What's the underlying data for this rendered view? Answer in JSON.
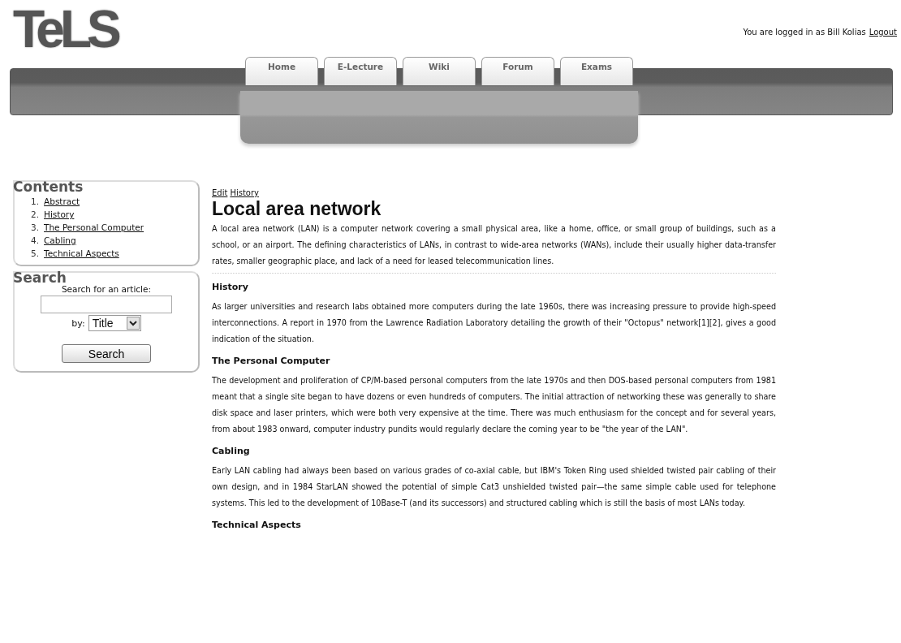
{
  "header": {
    "logo": "TeLS",
    "login_text": "You are logged in as Bill Kolias",
    "logout": "Logout"
  },
  "nav": {
    "tabs": [
      {
        "label": "Home"
      },
      {
        "label": "E-Lecture"
      },
      {
        "label": "Wiki"
      },
      {
        "label": "Forum"
      },
      {
        "label": "Exams"
      }
    ]
  },
  "sidebar": {
    "contents": {
      "title": "Contents",
      "items": [
        {
          "number": "1.",
          "label": "Abstract"
        },
        {
          "number": "2.",
          "label": "History"
        },
        {
          "number": "3.",
          "label": "The Personal Computer"
        },
        {
          "number": "4.",
          "label": "Cabling"
        },
        {
          "number": "5.",
          "label": "Technical Aspects"
        }
      ]
    },
    "search": {
      "title": "Search",
      "prompt": "Search for an article:",
      "by_label": "by:",
      "by_value": "Title",
      "button": "Search"
    }
  },
  "article": {
    "links": [
      "Edit",
      "History"
    ],
    "title": "Local area network",
    "intro": "A local area network (LAN) is a computer network covering a small physical area, like a home, office, or small group of buildings, such as a school, or an airport. The defining characteristics of LANs, in contrast to wide-area networks (WANs), include their usually higher data-transfer rates, smaller geographic place, and lack of a need for leased telecommunication lines.",
    "sections": [
      {
        "heading": "History",
        "text": "As larger universities and research labs obtained more computers during the late 1960s, there was increasing pressure to provide high-speed interconnections. A report in 1970 from the Lawrence Radiation Laboratory detailing the growth of their \"Octopus\" network[1][2], gives a good indication of the situation."
      },
      {
        "heading": "The Personal Computer",
        "text": "The development and proliferation of CP/M-based personal computers from the late 1970s and then DOS-based personal computers from 1981 meant that a single site began to have dozens or even hundreds of computers. The initial attraction of networking these was generally to share disk space and laser printers, which were both very expensive at the time. There was much enthusiasm for the concept and for several years, from about 1983 onward, computer industry pundits would regularly declare the coming year to be \"the year of the LAN\"."
      },
      {
        "heading": "Cabling",
        "text": "Early LAN cabling had always been based on various grades of co-axial cable, but IBM's Token Ring used shielded twisted pair cabling of their own design, and in 1984 StarLAN showed the potential of simple Cat3 unshielded twisted pair—the same simple cable used for telephone systems. This led to the development of 10Base-T (and its successors) and structured cabling which is still the basis of most LANs today."
      },
      {
        "heading": "Technical Aspects"
      }
    ]
  }
}
